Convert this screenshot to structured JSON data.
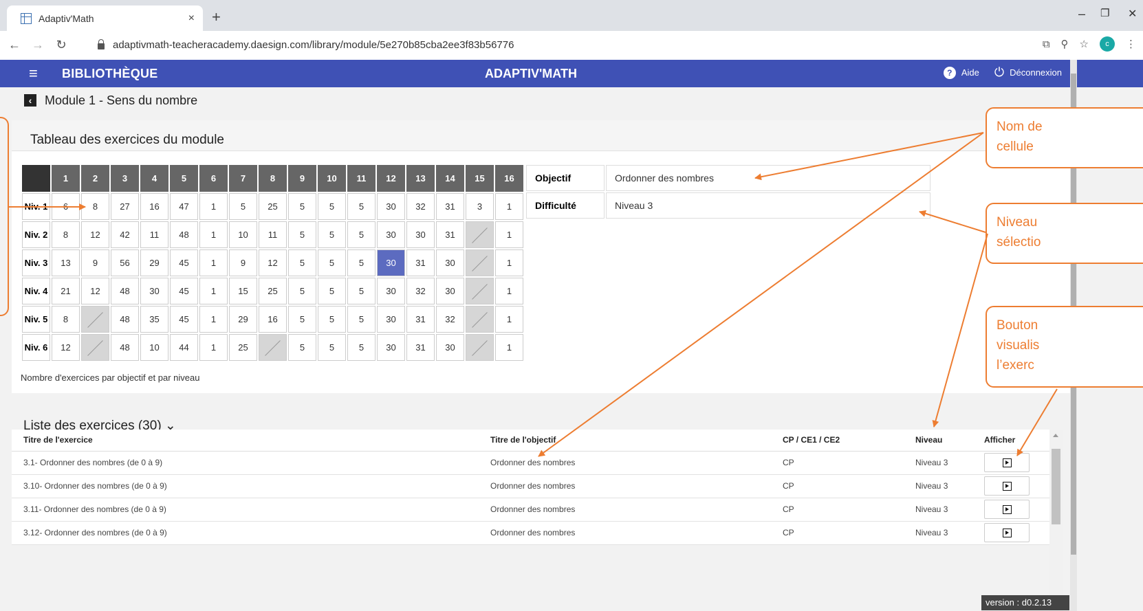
{
  "browser": {
    "tab_title": "Adaptiv'Math",
    "tab_close": "×",
    "new_tab": "+",
    "url": "adaptivmath-teacheracademy.daesign.com/library/module/5e270b85cba2ee3f83b56776",
    "avatar_letter": "c",
    "win_min": "–",
    "win_max": "❐",
    "win_close": "✕"
  },
  "app": {
    "section": "BIBLIOTHÈQUE",
    "title": "ADAPTIV'MATH",
    "help": "Aide",
    "logout": "Déconnexion",
    "accent": "#3f51b5"
  },
  "module": {
    "title": "Module 1 - Sens du nombre"
  },
  "tableau": {
    "heading": "Tableau des exercices du module",
    "columns": [
      "1",
      "2",
      "3",
      "4",
      "5",
      "6",
      "7",
      "8",
      "9",
      "10",
      "11",
      "12",
      "13",
      "14",
      "15",
      "16"
    ],
    "rows": [
      {
        "label": "Niv. 1",
        "cells": [
          "6",
          "8",
          "27",
          "16",
          "47",
          "1",
          "5",
          "25",
          "5",
          "5",
          "5",
          "30",
          "32",
          "31",
          "3",
          "1"
        ]
      },
      {
        "label": "Niv. 2",
        "cells": [
          "8",
          "12",
          "42",
          "11",
          "48",
          "1",
          "10",
          "11",
          "5",
          "5",
          "5",
          "30",
          "30",
          "31",
          "",
          "1"
        ]
      },
      {
        "label": "Niv. 3",
        "cells": [
          "13",
          "9",
          "56",
          "29",
          "45",
          "1",
          "9",
          "12",
          "5",
          "5",
          "5",
          "30",
          "31",
          "30",
          "",
          "1"
        ]
      },
      {
        "label": "Niv. 4",
        "cells": [
          "21",
          "12",
          "48",
          "30",
          "45",
          "1",
          "15",
          "25",
          "5",
          "5",
          "5",
          "30",
          "32",
          "30",
          "",
          "1"
        ]
      },
      {
        "label": "Niv. 5",
        "cells": [
          "8",
          "",
          "48",
          "35",
          "45",
          "1",
          "29",
          "16",
          "5",
          "5",
          "5",
          "30",
          "31",
          "32",
          "",
          "1"
        ]
      },
      {
        "label": "Niv. 6",
        "cells": [
          "12",
          "",
          "48",
          "10",
          "44",
          "1",
          "25",
          "",
          "5",
          "5",
          "5",
          "30",
          "31",
          "30",
          "",
          "1"
        ]
      }
    ],
    "selected": {
      "row": 2,
      "col": 11
    },
    "caption": "Nombre d'exercices par objectif et par niveau",
    "objectif_label": "Objectif",
    "objectif_value": "Ordonner des nombres",
    "difficulte_label": "Difficulté",
    "difficulte_value": "Niveau 3"
  },
  "liste": {
    "heading": "Liste des exercices (30) ⌄",
    "headers": [
      "Titre de l'exercice",
      "Titre de l'objectif",
      "CP / CE1 / CE2",
      "Niveau",
      "Afficher"
    ],
    "rows": [
      {
        "titre": "3.1- Ordonner des nombres (de 0 à 9)",
        "objectif": "Ordonner des nombres",
        "classe": "CP",
        "niveau": "Niveau 3"
      },
      {
        "titre": "3.10- Ordonner des nombres (de 0 à 9)",
        "objectif": "Ordonner des nombres",
        "classe": "CP",
        "niveau": "Niveau 3"
      },
      {
        "titre": "3.11- Ordonner des nombres (de 0 à 9)",
        "objectif": "Ordonner des nombres",
        "classe": "CP",
        "niveau": "Niveau 3"
      },
      {
        "titre": "3.12- Ordonner des nombres (de 0 à 9)",
        "objectif": "Ordonner des nombres",
        "classe": "CP",
        "niveau": "Niveau 3"
      }
    ]
  },
  "version": "version : d0.2.13",
  "annotations": {
    "callout_1": [
      "Nom de",
      "cellule"
    ],
    "callout_2": [
      "Niveau",
      "sélectio"
    ],
    "callout_3": [
      "Bouton",
      "visualis",
      "l’exerc"
    ],
    "color": "#ed7d31"
  }
}
